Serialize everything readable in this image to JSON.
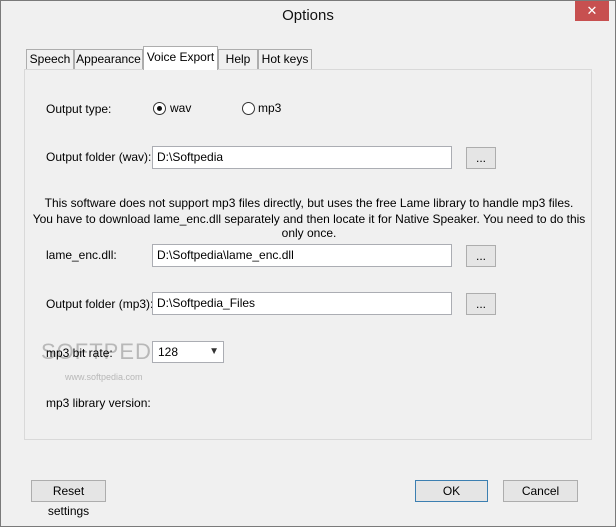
{
  "window": {
    "title": "Options",
    "close_glyph": "✕"
  },
  "tabs": [
    {
      "label": "Speech"
    },
    {
      "label": "Appearance"
    },
    {
      "label": "Voice Export",
      "active": true
    },
    {
      "label": "Help"
    },
    {
      "label": "Hot keys"
    }
  ],
  "voice_export": {
    "output_type_label": "Output type:",
    "options": [
      {
        "label": "wav",
        "selected": true
      },
      {
        "label": "mp3",
        "selected": false
      }
    ],
    "output_folder_wav_label": "Output folder (wav):",
    "output_folder_wav_value": "D:\\Softpedia",
    "browse_label": "...",
    "note_line1": "This software does not support mp3 files directly, but uses the free Lame library to handle mp3 files.",
    "note_line2": "You have to download lame_enc.dll separately and then locate it for Native Speaker. You need to do this only once.",
    "lame_enc_label": "lame_enc.dll:",
    "lame_enc_value": "D:\\Softpedia\\lame_enc.dll",
    "output_folder_mp3_label": "Output folder (mp3):",
    "output_folder_mp3_value": "D:\\Softpedia_Files",
    "bitrate_label": "mp3 bit rate:",
    "bitrate_value": "128",
    "library_version_label": "mp3 library version:"
  },
  "watermark": {
    "brand": "SOFTPEDIA",
    "url": "www.softpedia.com"
  },
  "footer": {
    "reset_label": "Reset settings",
    "ok_label": "OK",
    "cancel_label": "Cancel"
  }
}
